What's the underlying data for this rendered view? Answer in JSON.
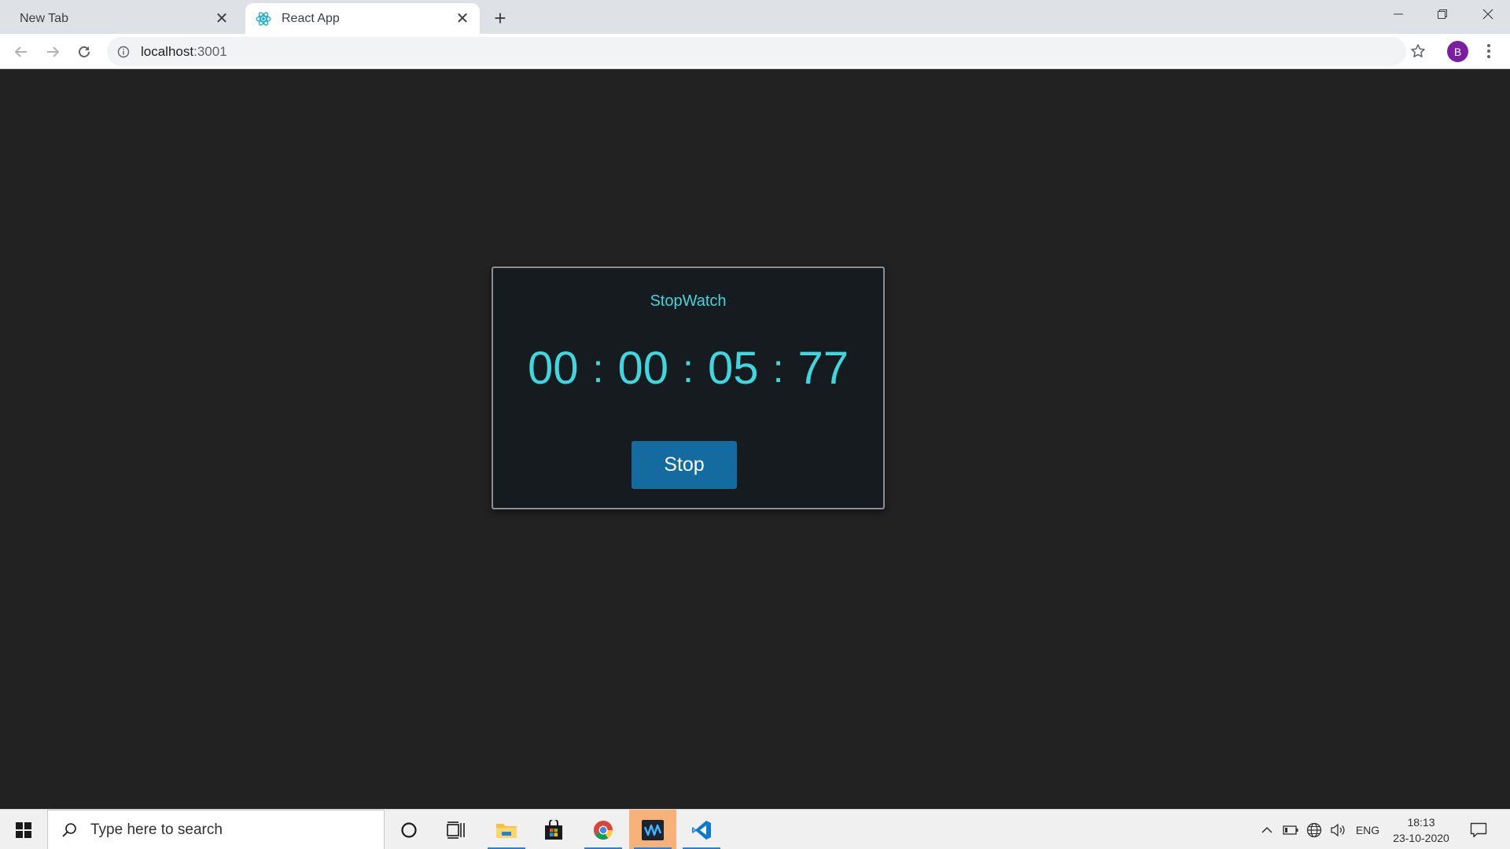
{
  "browser": {
    "tabs": [
      {
        "title": "New Tab",
        "active": false,
        "favicon": "none"
      },
      {
        "title": "React App",
        "active": true,
        "favicon": "react-icon"
      }
    ],
    "url": {
      "host": "localhost",
      "port": ":3001"
    },
    "profile_initial": "B",
    "profile_color": "#7b1fa2"
  },
  "app": {
    "title": "StopWatch",
    "timer": {
      "hours": "00",
      "minutes": "00",
      "seconds": "05",
      "centiseconds": "77",
      "separator": ":"
    },
    "button_label": "Stop",
    "colors": {
      "accent": "#40d6de",
      "card_bg": "#161b1f",
      "page_bg": "#222222",
      "button_bg": "#136b9f"
    }
  },
  "taskbar": {
    "search_placeholder": "Type here to search",
    "apps": [
      "cortana-icon",
      "task-view-icon",
      "file-explorer-icon",
      "store-icon",
      "chrome-icon",
      "waveform-app-icon",
      "vscode-icon"
    ],
    "language": "ENG",
    "time": "18:13",
    "date": "23-10-2020"
  }
}
